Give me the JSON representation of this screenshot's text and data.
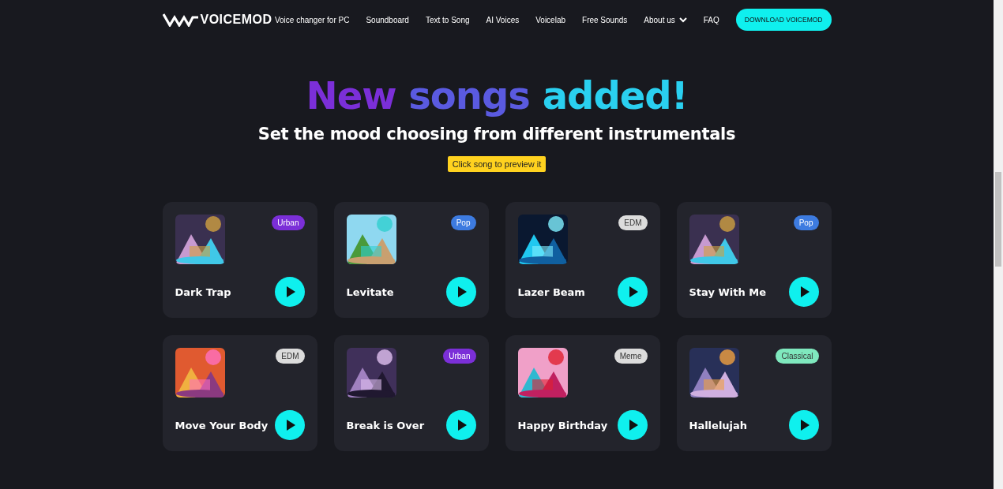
{
  "header": {
    "logo": "VOICEMOD",
    "nav": [
      {
        "label": "Voice changer for PC",
        "kind": "link"
      },
      {
        "label": "Soundboard",
        "kind": "link"
      },
      {
        "label": "Text to Song",
        "kind": "link"
      },
      {
        "label": "AI Voices",
        "kind": "link"
      },
      {
        "label": "Voicelab",
        "kind": "link"
      },
      {
        "label": "Free Sounds",
        "kind": "link"
      },
      {
        "label": "About us",
        "kind": "dropdown"
      },
      {
        "label": "FAQ",
        "kind": "link"
      }
    ],
    "cta": "DOWNLOAD VOICEMOD"
  },
  "hero": {
    "title_words": [
      "New",
      "songs",
      "added!"
    ],
    "subtitle": "Set the mood choosing from different instrumentals",
    "hint": "Click song to preview it"
  },
  "songs": [
    {
      "title": "Dark Trap",
      "tag": "Urban",
      "color": "#7b2fd8"
    },
    {
      "title": "Levitate",
      "tag": "Pop",
      "color": "#3d7be0"
    },
    {
      "title": "Lazer Beam",
      "tag": "EDM",
      "color": "#dcdcdc"
    },
    {
      "title": "Stay With Me",
      "tag": "Pop",
      "color": "#3d7be0"
    },
    {
      "title": "Move Your Body",
      "tag": "EDM",
      "color": "#dcdcdc"
    },
    {
      "title": "Break is Over",
      "tag": "Urban",
      "color": "#7b2fd8"
    },
    {
      "title": "Happy Birthday",
      "tag": "Meme",
      "color": "#dcdcdc"
    },
    {
      "title": "Hallelujah",
      "tag": "Classical",
      "color": "#7fe8be"
    }
  ]
}
